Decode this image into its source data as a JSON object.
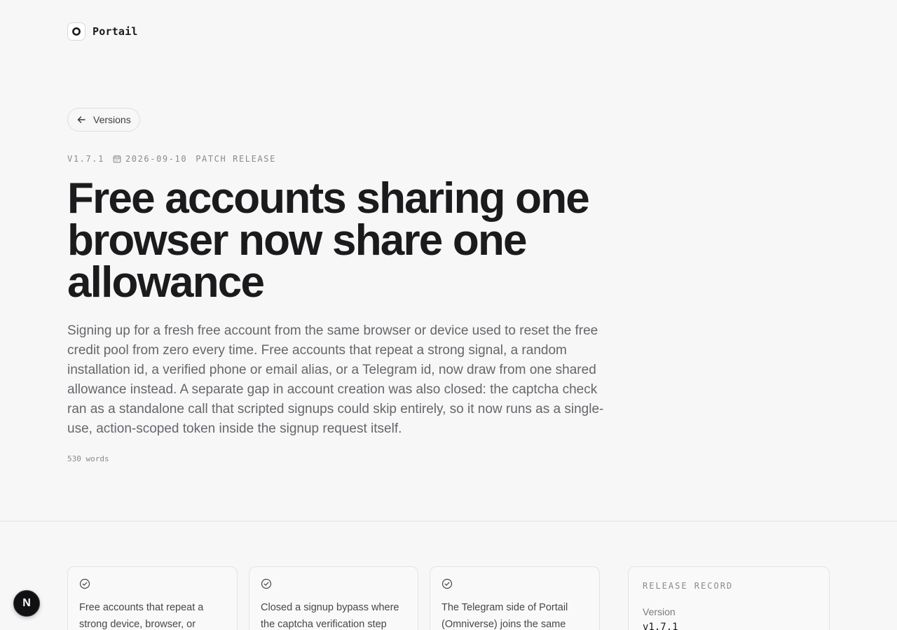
{
  "brand": {
    "name": "Portail",
    "icon": "portail-logo-icon"
  },
  "nav": {
    "back_label": "Versions",
    "back_icon": "arrow-left-icon"
  },
  "release": {
    "version": "V1.7.1",
    "date_icon": "calendar-icon",
    "date": "2026-09-10",
    "type": "PATCH RELEASE",
    "title": "Free accounts sharing one browser now share one allowance",
    "summary": "Signing up for a fresh free account from the same browser or device used to reset the free credit pool from zero every time. Free accounts that repeat a strong signal, a random installation id, a verified phone or email alias, or a Telegram id, now draw from one shared allowance instead. A separate gap in account creation was also closed: the captcha check ran as a standalone call that scripted signups could skip entirely, so it now runs as a single-use, action-scoped token inside the signup request itself.",
    "word_count": "530 words"
  },
  "highlights": [
    {
      "icon": "check-circle-icon",
      "text": "Free accounts that repeat a strong device, browser, or"
    },
    {
      "icon": "check-circle-icon",
      "text": "Closed a signup bypass where the captcha verification step"
    },
    {
      "icon": "check-circle-icon",
      "text": "The Telegram side of Portail (Omniverse) joins the same"
    }
  ],
  "record": {
    "heading": "RELEASE RECORD",
    "version_label": "Version",
    "version_value": "v1.7.1"
  },
  "floating_badge": {
    "label": "N",
    "icon": "next-dev-tools-icon"
  },
  "colors": {
    "background": "#f7f7f7",
    "text": "#1b1b1d",
    "muted": "#66666c",
    "border": "#e3e3e6"
  }
}
